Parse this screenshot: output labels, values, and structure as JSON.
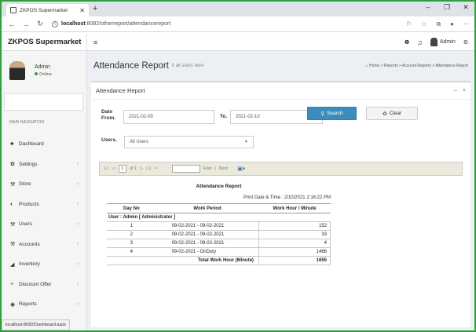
{
  "browser": {
    "tab_title": "ZKPOS Supermarket",
    "url_host": "localhost",
    "url_path": ":8082/otherreport/attendancereport"
  },
  "app": {
    "brand": "ZKPOS Supermarket",
    "user_top": "Admin"
  },
  "sidebar": {
    "user_name": "Admin",
    "user_status": "Online",
    "nav_header": "MAIN NAVIGATION",
    "items": [
      {
        "label": "Dashboard",
        "icon": "dashboard-icon"
      },
      {
        "label": "Settings",
        "icon": "gear-icon"
      },
      {
        "label": "Store",
        "icon": "store-icon"
      },
      {
        "label": "Products",
        "icon": "products-icon"
      },
      {
        "label": "Users",
        "icon": "users-icon"
      },
      {
        "label": "Accounts",
        "icon": "accounts-icon"
      },
      {
        "label": "Inventory",
        "icon": "inventory-icon"
      },
      {
        "label": "Discount Offer",
        "icon": "plus-icon"
      },
      {
        "label": "Reports",
        "icon": "reports-icon"
      }
    ],
    "status_url": "localhost:8082/Dashboard.aspx"
  },
  "page": {
    "title": "Attendance Report",
    "subtitle": "it all starts here",
    "breadcrumb": "Home > Reports > Account Reports > Attendance Report",
    "box_title": "Attendance Report"
  },
  "filters": {
    "date_from_label": "Date From.",
    "date_from_value": "2021-02-09",
    "to_label": "To.",
    "to_value": "2021-02-10",
    "users_label": "Users.",
    "users_value": "All Users",
    "search_label": "Search",
    "clear_label": "Clear"
  },
  "toolbar": {
    "page": "1",
    "of": "of 1",
    "find": "Find",
    "next": "Next"
  },
  "report": {
    "title": "Attendance Report",
    "print_date": "Print Date & Time : 2/10/2021 2:16:22 PM",
    "headers": [
      "Day No",
      "Work Period",
      "Work Hour / Minute"
    ],
    "group": "User : Admin [ Administrator ]",
    "rows": [
      {
        "day": "1",
        "period": "09-02-2021 - 09-02-2021",
        "hours": "152"
      },
      {
        "day": "2",
        "period": "09-02-2021 - 09-02-2021",
        "hours": "33"
      },
      {
        "day": "3",
        "period": "09-02-2021 - 09-02-2021",
        "hours": "4"
      },
      {
        "day": "4",
        "period": "09-02-2021 - OnDuty",
        "hours": "1466"
      }
    ],
    "total_label": "Total Work Hour (Minute)",
    "total_value": "1655"
  }
}
